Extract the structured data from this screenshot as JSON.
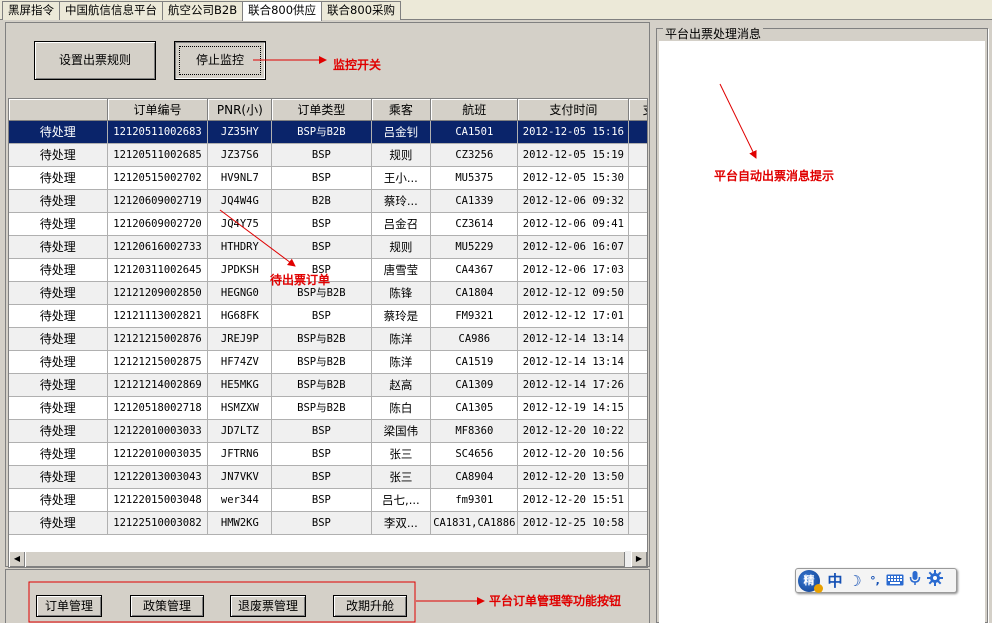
{
  "tabs": [
    {
      "label": "黑屏指令",
      "active": false
    },
    {
      "label": "中国航信信息平台",
      "active": false
    },
    {
      "label": "航空公司B2B",
      "active": false
    },
    {
      "label": "联合800供应",
      "active": true
    },
    {
      "label": "联合800采购",
      "active": false
    }
  ],
  "toolbar": {
    "set_rule_label": "设置出票规则",
    "stop_monitor_label": "停止监控"
  },
  "grid": {
    "columns": [
      "",
      "订单编号",
      "PNR(小)",
      "订单类型",
      "乘客",
      "航班",
      "支付时间",
      "支"
    ],
    "rows": [
      {
        "status": "待处理",
        "order_no": "12120511002683",
        "pnr": "JZ35HY",
        "type": "BSP与B2B",
        "passenger": "吕金钊",
        "flight": "CA1501",
        "paid_at": "2012-12-05 15:16",
        "selected": true
      },
      {
        "status": "待处理",
        "order_no": "12120511002685",
        "pnr": "JZ37S6",
        "type": "BSP",
        "passenger": "规则",
        "flight": "CZ3256",
        "paid_at": "2012-12-05 15:19"
      },
      {
        "status": "待处理",
        "order_no": "12120515002702",
        "pnr": "HV9NL7",
        "type": "BSP",
        "passenger": "王小...",
        "flight": "MU5375",
        "paid_at": "2012-12-05 15:30"
      },
      {
        "status": "待处理",
        "order_no": "12120609002719",
        "pnr": "JQ4W4G",
        "type": "B2B",
        "passenger": "蔡玲...",
        "flight": "CA1339",
        "paid_at": "2012-12-06 09:32"
      },
      {
        "status": "待处理",
        "order_no": "12120609002720",
        "pnr": "JQ4Y75",
        "type": "BSP",
        "passenger": "吕金召",
        "flight": "CZ3614",
        "paid_at": "2012-12-06 09:41"
      },
      {
        "status": "待处理",
        "order_no": "12120616002733",
        "pnr": "HTHDRY",
        "type": "BSP",
        "passenger": "规则",
        "flight": "MU5229",
        "paid_at": "2012-12-06 16:07"
      },
      {
        "status": "待处理",
        "order_no": "12120311002645",
        "pnr": "JPDKSH",
        "type": "BSP",
        "passenger": "唐雪莹",
        "flight": "CA4367",
        "paid_at": "2012-12-06 17:03"
      },
      {
        "status": "待处理",
        "order_no": "12121209002850",
        "pnr": "HEGNG0",
        "type": "BSP与B2B",
        "passenger": "陈锋",
        "flight": "CA1804",
        "paid_at": "2012-12-12 09:50"
      },
      {
        "status": "待处理",
        "order_no": "12121113002821",
        "pnr": "HG68FK",
        "type": "BSP",
        "passenger": "蔡玲是",
        "flight": "FM9321",
        "paid_at": "2012-12-12 17:01"
      },
      {
        "status": "待处理",
        "order_no": "12121215002876",
        "pnr": "JREJ9P",
        "type": "BSP与B2B",
        "passenger": "陈洋",
        "flight": "CA986",
        "paid_at": "2012-12-14 13:14"
      },
      {
        "status": "待处理",
        "order_no": "12121215002875",
        "pnr": "HF74ZV",
        "type": "BSP与B2B",
        "passenger": "陈洋",
        "flight": "CA1519",
        "paid_at": "2012-12-14 13:14"
      },
      {
        "status": "待处理",
        "order_no": "12121214002869",
        "pnr": "HE5MKG",
        "type": "BSP与B2B",
        "passenger": "赵高",
        "flight": "CA1309",
        "paid_at": "2012-12-14 17:26"
      },
      {
        "status": "待处理",
        "order_no": "12120518002718",
        "pnr": "HSMZXW",
        "type": "BSP与B2B",
        "passenger": "陈白",
        "flight": "CA1305",
        "paid_at": "2012-12-19 14:15"
      },
      {
        "status": "待处理",
        "order_no": "12122010003033",
        "pnr": "JD7LTZ",
        "type": "BSP",
        "passenger": "梁国伟",
        "flight": "MF8360",
        "paid_at": "2012-12-20 10:22"
      },
      {
        "status": "待处理",
        "order_no": "12122010003035",
        "pnr": "JFTRN6",
        "type": "BSP",
        "passenger": "张三",
        "flight": "SC4656",
        "paid_at": "2012-12-20 10:56"
      },
      {
        "status": "待处理",
        "order_no": "12122013003043",
        "pnr": "JN7VKV",
        "type": "BSP",
        "passenger": "张三",
        "flight": "CA8904",
        "paid_at": "2012-12-20 13:50"
      },
      {
        "status": "待处理",
        "order_no": "12122015003048",
        "pnr": "wer344",
        "type": "BSP",
        "passenger": "吕七,...",
        "flight": "fm9301",
        "paid_at": "2012-12-20 15:51"
      },
      {
        "status": "待处理",
        "order_no": "12122510003082",
        "pnr": "HMW2KG",
        "type": "BSP",
        "passenger": "李双...",
        "flight": "CA1831,CA1886",
        "paid_at": "2012-12-25 10:58"
      }
    ]
  },
  "bottom_buttons": {
    "order_mgmt": "订单管理",
    "policy_mgmt": "政策管理",
    "refund_mgmt": "退废票管理",
    "change_upgrade": "改期升舱"
  },
  "right_panel": {
    "title": "平台出票处理消息"
  },
  "annotations": {
    "monitor_switch": "监控开关",
    "pending_orders": "待出票订单",
    "auto_msg_tip": "平台自动出票消息提示",
    "function_buttons": "平台订单管理等功能按钮"
  },
  "ime": {
    "logo_char": "精",
    "icons": [
      "中",
      "☽",
      "°,",
      "keyboard-icon",
      "microphone-icon",
      "gear-icon"
    ]
  },
  "colors": {
    "selection": "#0a246a",
    "annotation": "#e00000",
    "window_bg": "#d4d0c8"
  }
}
